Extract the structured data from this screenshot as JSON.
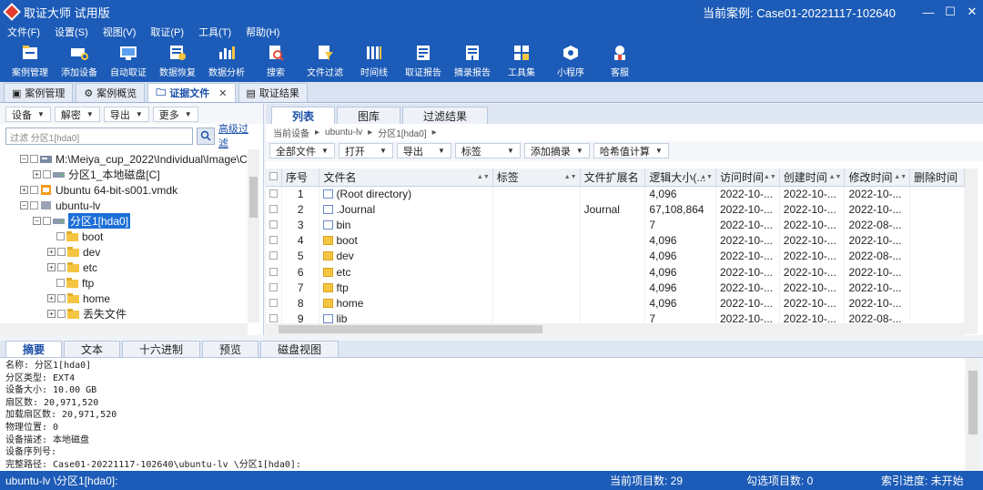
{
  "window": {
    "title": "取证大师 试用版",
    "current_case": "当前案例:  Case01-20221117-102640"
  },
  "menu": [
    "文件(F)",
    "设置(S)",
    "视图(V)",
    "取证(P)",
    "工具(T)",
    "帮助(H)"
  ],
  "toolbar": [
    {
      "label": "案例管理",
      "icon": "case-management-icon"
    },
    {
      "label": "添加设备",
      "icon": "add-device-icon"
    },
    {
      "label": "自动取证",
      "icon": "auto-forensics-icon"
    },
    {
      "label": "数据恢复",
      "icon": "data-recovery-icon"
    },
    {
      "label": "数据分析",
      "icon": "data-analysis-icon"
    },
    {
      "label": "搜索",
      "icon": "search-icon"
    },
    {
      "label": "文件过滤",
      "icon": "file-filter-icon"
    },
    {
      "label": "时间线",
      "icon": "timeline-icon"
    },
    {
      "label": "取证报告",
      "icon": "forensics-report-icon"
    },
    {
      "label": "摘录报告",
      "icon": "excerpt-report-icon"
    },
    {
      "label": "工具集",
      "icon": "toolset-icon"
    },
    {
      "label": "小程序",
      "icon": "mini-program-icon"
    },
    {
      "label": "客服",
      "icon": "customer-service-icon"
    }
  ],
  "doc_tabs": [
    "案例管理",
    "案例概览",
    "证据文件",
    "取证结果"
  ],
  "left": {
    "tools": [
      "设备",
      "解密",
      "导出",
      "更多"
    ],
    "filter_placeholder": "过滤 分区1[hda0]",
    "advanced_filter": "高级过滤",
    "tree": [
      {
        "label": "M:\\Meiya_cup_2022\\Individual\\Image\\C"
      },
      {
        "label": "分区1_本地磁盘[C]"
      },
      {
        "label": "Ubuntu 64-bit-s001.vmdk"
      },
      {
        "label": "ubuntu-lv"
      },
      {
        "label": "分区1[hda0]"
      },
      {
        "label": "boot"
      },
      {
        "label": "dev"
      },
      {
        "label": "etc"
      },
      {
        "label": "ftp"
      },
      {
        "label": "home"
      },
      {
        "label": "丢失文件"
      }
    ]
  },
  "right": {
    "tabs": [
      "列表",
      "图库",
      "过滤结果"
    ],
    "breadcrumb": [
      "当前设备",
      "ubuntu-lv",
      "分区1[hda0]"
    ],
    "tools": [
      "全部文件",
      "打开",
      "导出",
      "标签",
      "添加摘录",
      "哈希值计算"
    ],
    "columns": [
      "序号",
      "文件名",
      "标签",
      "文件扩展名",
      "逻辑大小(...",
      "访问时间",
      "创建时间",
      "修改时间",
      "删除时间"
    ],
    "rows": [
      {
        "n": "1",
        "name": "(Root directory)",
        "ext": "",
        "size": "4,096",
        "atime": "2022-10-...",
        "ctime": "2022-10-...",
        "mtime": "2022-10-..."
      },
      {
        "n": "2",
        "name": ".Journal",
        "ext": "Journal",
        "size": "67,108,864",
        "atime": "2022-10-...",
        "ctime": "2022-10-...",
        "mtime": "2022-10-..."
      },
      {
        "n": "3",
        "name": "bin",
        "ext": "",
        "size": "7",
        "atime": "2022-10-...",
        "ctime": "2022-10-...",
        "mtime": "2022-08-..."
      },
      {
        "n": "4",
        "name": "boot",
        "ext": "",
        "size": "4,096",
        "atime": "2022-10-...",
        "ctime": "2022-10-...",
        "mtime": "2022-10-..."
      },
      {
        "n": "5",
        "name": "dev",
        "ext": "",
        "size": "4,096",
        "atime": "2022-10-...",
        "ctime": "2022-10-...",
        "mtime": "2022-08-..."
      },
      {
        "n": "6",
        "name": "etc",
        "ext": "",
        "size": "4,096",
        "atime": "2022-10-...",
        "ctime": "2022-10-...",
        "mtime": "2022-10-..."
      },
      {
        "n": "7",
        "name": "ftp",
        "ext": "",
        "size": "4,096",
        "atime": "2022-10-...",
        "ctime": "2022-10-...",
        "mtime": "2022-10-..."
      },
      {
        "n": "8",
        "name": "home",
        "ext": "",
        "size": "4,096",
        "atime": "2022-10-...",
        "ctime": "2022-10-...",
        "mtime": "2022-10-..."
      },
      {
        "n": "9",
        "name": "lib",
        "ext": "",
        "size": "7",
        "atime": "2022-10-...",
        "ctime": "2022-10-...",
        "mtime": "2022-08-..."
      }
    ]
  },
  "bottom": {
    "tabs": [
      "摘要",
      "文本",
      "十六进制",
      "预览",
      "磁盘视图"
    ],
    "summary": [
      "名称: 分区1[hda0]",
      "分区类型: EXT4",
      "设备大小: 10.00 GB",
      "扇区数: 20,971,520",
      "加载扇区数: 20,971,520",
      "物理位置: 0",
      "设备描述: 本地磁盘",
      "设备序列号:",
      "完整路径: Case01-20221117-102640\\ubuntu-lv \\分区1[hda0]:"
    ]
  },
  "status": {
    "path": "ubuntu-lv \\分区1[hda0]:",
    "current_items": "当前项目数: 29",
    "checked_items": "勾选项目数: 0",
    "index_progress": "索引进度: 未开始"
  }
}
